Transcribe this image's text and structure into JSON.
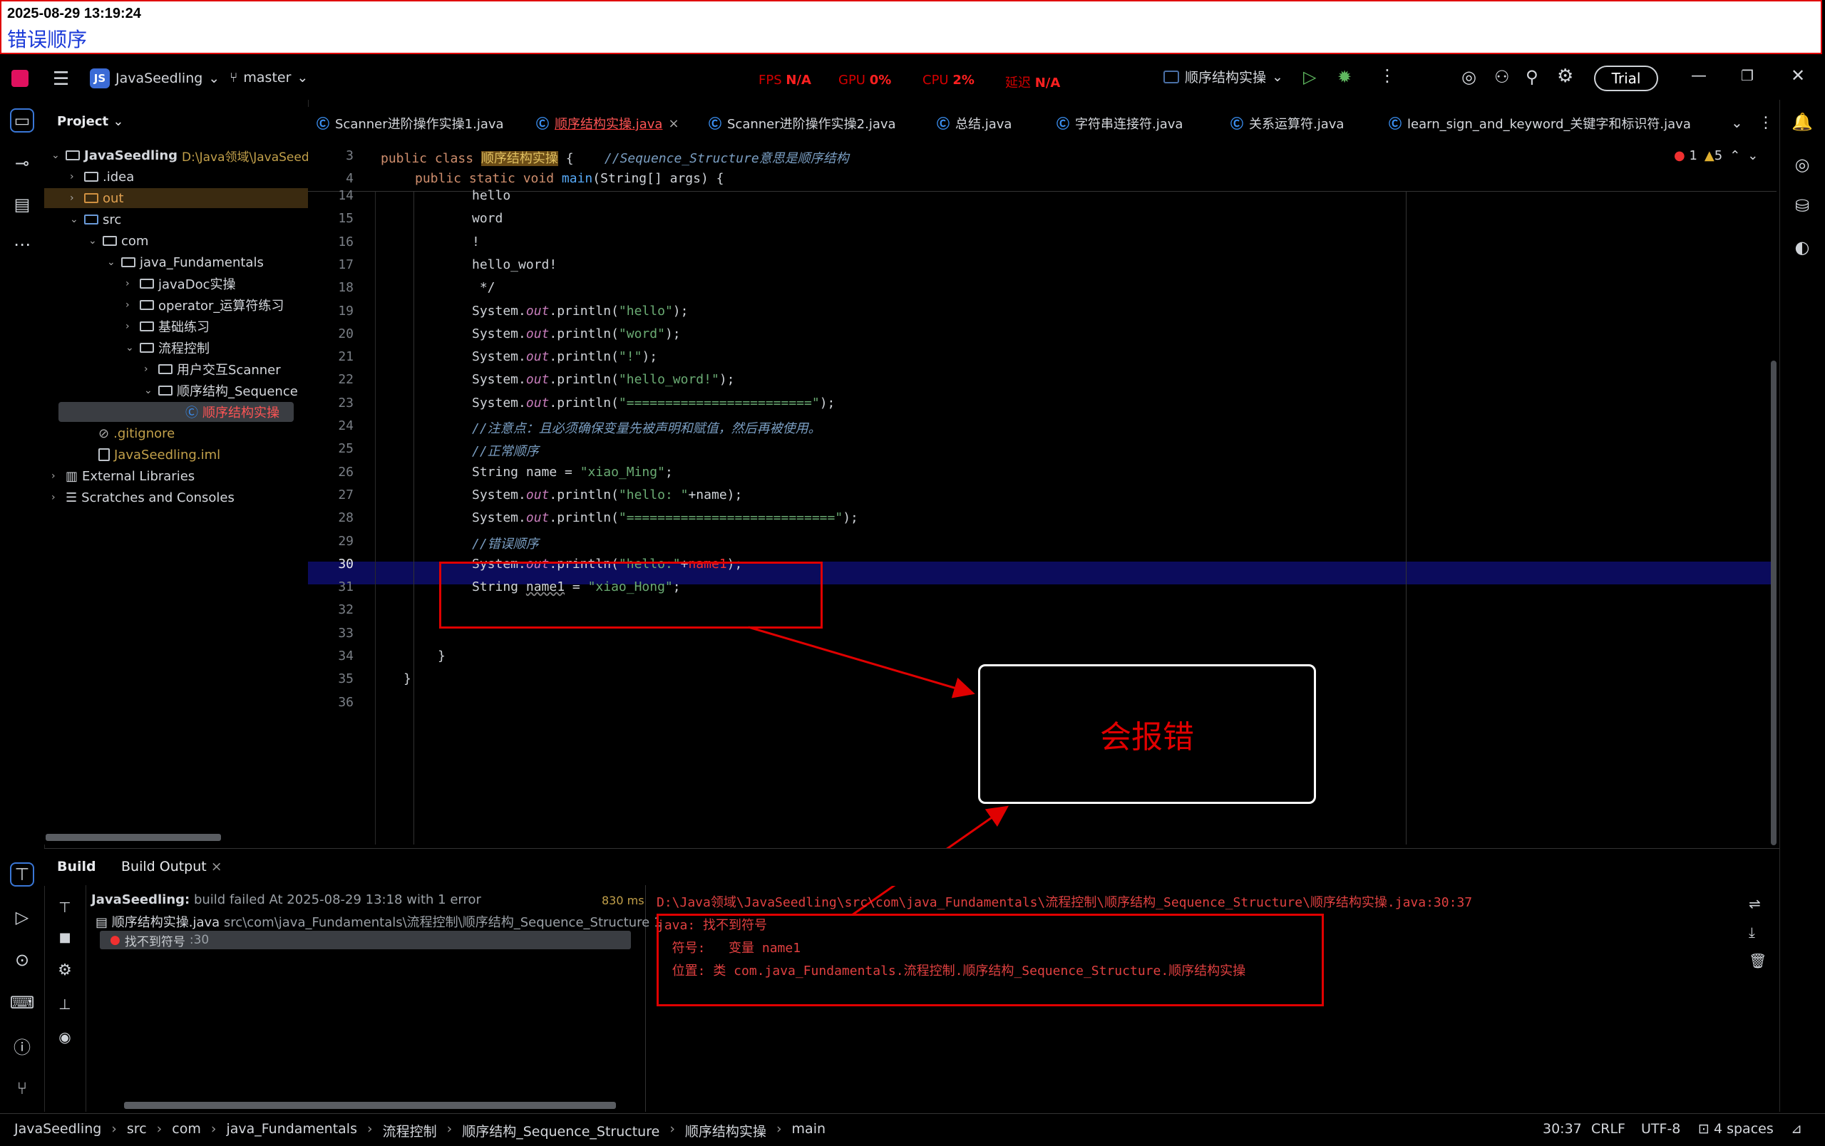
{
  "annotation": {
    "timestamp": "2025-08-29 13:19:24",
    "title": "错误顺序",
    "callout": "会报错"
  },
  "titlebar": {
    "project_badge": "JS",
    "project_name": "JavaSeedling",
    "branch": "master",
    "metrics": [
      {
        "label": "FPS",
        "value": "N/A"
      },
      {
        "label": "GPU",
        "value": "0%"
      },
      {
        "label": "CPU",
        "value": "2%"
      },
      {
        "label": "延迟",
        "value": "N/A"
      }
    ],
    "run_config": "顺序结构实操",
    "trial": "Trial"
  },
  "project_panel": {
    "header": "Project",
    "tree": [
      {
        "label": "JavaSeedling",
        "extra": "D:\\Java领域\\JavaSeed"
      },
      {
        "label": ".idea"
      },
      {
        "label": "out"
      },
      {
        "label": "src"
      },
      {
        "label": "com"
      },
      {
        "label": "java_Fundamentals"
      },
      {
        "label": "javaDoc实操"
      },
      {
        "label": "operator_运算符练习"
      },
      {
        "label": "基础练习"
      },
      {
        "label": "流程控制"
      },
      {
        "label": "用户交互Scanner"
      },
      {
        "label": "顺序结构_Sequence"
      },
      {
        "label": "顺序结构实操"
      },
      {
        "label": ".gitignore"
      },
      {
        "label": "JavaSeedling.iml"
      },
      {
        "label": "External Libraries"
      },
      {
        "label": "Scratches and Consoles"
      }
    ]
  },
  "tabs": [
    "Scanner进阶操作实操1.java",
    "顺序结构实操.java",
    "Scanner进阶操作实操2.java",
    "总结.java",
    "字符串连接符.java",
    "关系运算符.java",
    "learn_sign_and_keyword_关键字和标识符.java"
  ],
  "editor": {
    "inspections": {
      "errors": "1",
      "warnings": "5"
    },
    "sticky": [
      {
        "ln": "3",
        "a": "public class ",
        "cls": "顺序结构实操",
        "b": " {    ",
        "cmt": "//Sequence_Structure意思是顺序结构"
      },
      {
        "ln": "4",
        "a": "public static void ",
        "m": "main",
        "b": "(String[] args) {"
      }
    ],
    "lines": [
      {
        "ln": "14",
        "t": "hello"
      },
      {
        "ln": "15",
        "t": "word"
      },
      {
        "ln": "16",
        "t": "!"
      },
      {
        "ln": "17",
        "t": "hello_word!"
      },
      {
        "ln": "18",
        "t": " */"
      },
      {
        "ln": "19",
        "pre": "System.",
        "fld": "out",
        "mid": ".println(",
        "str": "\"hello\"",
        "post": ");"
      },
      {
        "ln": "20",
        "pre": "System.",
        "fld": "out",
        "mid": ".println(",
        "str": "\"word\"",
        "post": ");"
      },
      {
        "ln": "21",
        "pre": "System.",
        "fld": "out",
        "mid": ".println(",
        "str": "\"!\"",
        "post": ");"
      },
      {
        "ln": "22",
        "pre": "System.",
        "fld": "out",
        "mid": ".println(",
        "str": "\"hello_word!\"",
        "post": ");"
      },
      {
        "ln": "23",
        "pre": "System.",
        "fld": "out",
        "mid": ".println(",
        "str": "\"========================\"",
        "post": ");"
      },
      {
        "ln": "24",
        "cmt": "//注意点：且必须确保变量先被声明和赋值，然后再被使用。"
      },
      {
        "ln": "25",
        "cmt": "//正常顺序"
      },
      {
        "ln": "26",
        "pre": "String name = ",
        "str": "\"xiao_Ming\"",
        "post": ";"
      },
      {
        "ln": "27",
        "pre": "System.",
        "fld": "out",
        "mid": ".println(",
        "str": "\"hello: \"",
        "post": "+name);"
      },
      {
        "ln": "28",
        "pre": "System.",
        "fld": "out",
        "mid": ".println(",
        "str": "\"===========================\"",
        "post": ");"
      },
      {
        "ln": "29",
        "cmt": "//错误顺序"
      },
      {
        "ln": "30",
        "pre": "System.",
        "fld": "out",
        "mid": ".println(",
        "str": "\"hello:\"",
        "post": "+",
        "err": "name1",
        "post2": ");"
      },
      {
        "ln": "31",
        "pre": "String ",
        "var": "name1",
        "post": " = ",
        "str": "\"xiao_Hong\"",
        "post2": ";"
      },
      {
        "ln": "32",
        "t": ""
      },
      {
        "ln": "33",
        "t": ""
      },
      {
        "ln": "34",
        "t": "}"
      },
      {
        "ln": "35",
        "t": "}"
      },
      {
        "ln": "36",
        "t": ""
      }
    ]
  },
  "build": {
    "tab_build": "Build",
    "tab_output": "Build Output",
    "summary_project": "JavaSeedling:",
    "summary_text": " build failed At 2025-08-29 13:18 with 1 error",
    "summary_time": "830 ms",
    "file": "顺序结构实操.java",
    "file_path": "src\\com\\java_Fundamentals\\流程控制\\顺序结构_Sequence_Structure 1",
    "error_item": "找不到符号",
    "error_loc": ":30",
    "output": [
      "D:\\Java领域\\JavaSeedling\\src\\com\\java_Fundamentals\\流程控制\\顺序结构_Sequence_Structure\\顺序结构实操.java:30:37",
      "java: 找不到符号",
      "  符号:   变量 name1",
      "  位置: 类 com.java_Fundamentals.流程控制.顺序结构_Sequence_Structure.顺序结构实操"
    ]
  },
  "statusbar": {
    "crumbs": [
      "JavaSeedling",
      "src",
      "com",
      "java_Fundamentals",
      "流程控制",
      "顺序结构_Sequence_Structure",
      "顺序结构实操",
      "main"
    ],
    "position": "30:37",
    "line_sep": "CRLF",
    "encoding": "UTF-8",
    "indent": "4 spaces"
  }
}
